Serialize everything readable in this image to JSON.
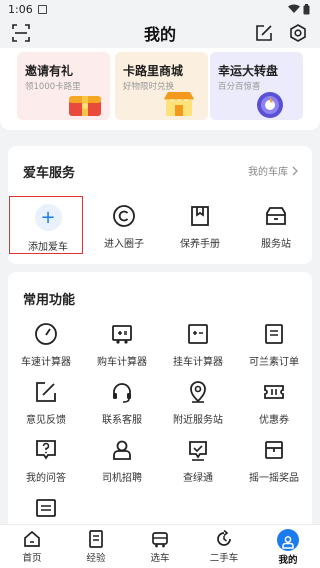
{
  "status_bar": {
    "time": "1:06"
  },
  "header": {
    "title": "我的",
    "icons": [
      "scan-icon",
      "edit-icon",
      "settings-icon"
    ]
  },
  "promo": [
    {
      "title": "邀请有礼",
      "subtitle": "领1000卡路里",
      "icon": "gift-chest-icon"
    },
    {
      "title": "卡路里商城",
      "subtitle": "好物限时兑换",
      "icon": "shop-icon"
    },
    {
      "title": "幸运大转盘",
      "subtitle": "百分百惊喜",
      "icon": "wheel-icon"
    }
  ],
  "car_service": {
    "title": "爱车服务",
    "link_label": "我的车库",
    "items": [
      {
        "label": "添加爱车",
        "icon": "plus-icon"
      },
      {
        "label": "进入圈子",
        "icon": "circle-icon"
      },
      {
        "label": "保养手册",
        "icon": "manual-icon"
      },
      {
        "label": "服务站",
        "icon": "service-station-icon"
      }
    ]
  },
  "common_functions": {
    "title": "常用功能",
    "items": [
      {
        "label": "车速计算器",
        "icon": "speedometer-icon"
      },
      {
        "label": "购车计算器",
        "icon": "truck-calculator-icon"
      },
      {
        "label": "挂车计算器",
        "icon": "trailer-calculator-icon"
      },
      {
        "label": "可兰素订单",
        "icon": "order-icon"
      },
      {
        "label": "意见反馈",
        "icon": "feedback-icon"
      },
      {
        "label": "联系客服",
        "icon": "headset-icon"
      },
      {
        "label": "附近服务站",
        "icon": "location-icon"
      },
      {
        "label": "优惠券",
        "icon": "coupon-icon"
      },
      {
        "label": "我的问答",
        "icon": "question-icon"
      },
      {
        "label": "司机招聘",
        "icon": "driver-icon"
      },
      {
        "label": "查绿通",
        "icon": "green-channel-icon"
      },
      {
        "label": "摇一摇奖品",
        "icon": "prize-box-icon"
      },
      {
        "label": "",
        "icon": "list-icon"
      }
    ]
  },
  "tabbar": {
    "items": [
      {
        "label": "首页",
        "icon": "home-icon"
      },
      {
        "label": "经验",
        "icon": "experience-icon"
      },
      {
        "label": "选车",
        "icon": "car-select-icon"
      },
      {
        "label": "二手车",
        "icon": "used-car-icon"
      },
      {
        "label": "我的",
        "icon": "profile-icon"
      }
    ],
    "active_index": 4
  },
  "colors": {
    "accent": "#1a7cf0",
    "highlight_border": "#e0312f",
    "background": "#f2f3f5"
  }
}
